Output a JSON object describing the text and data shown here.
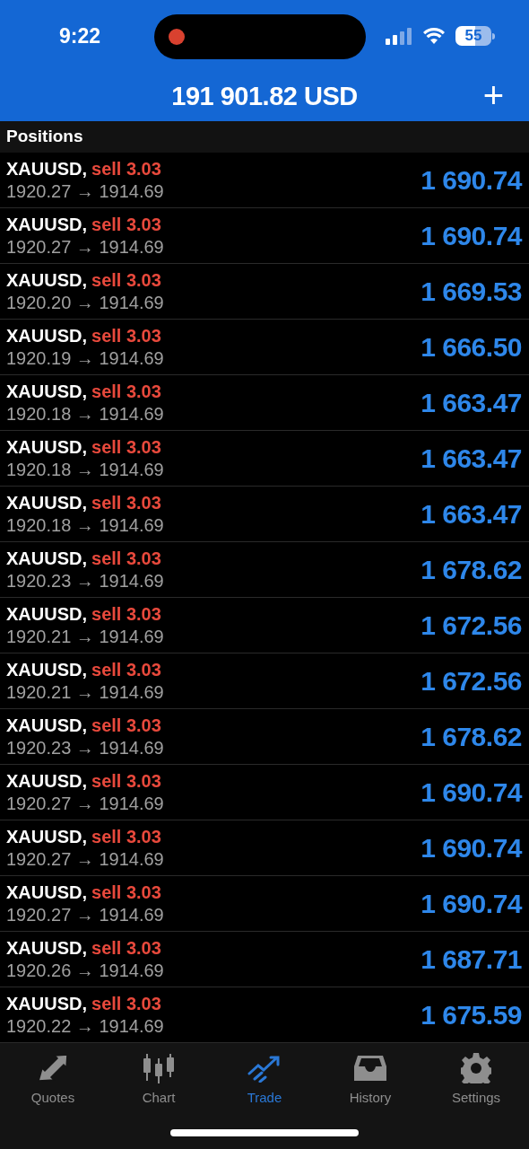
{
  "status_bar": {
    "time": "9:22",
    "battery": "55",
    "recording": true
  },
  "header": {
    "balance": "191 901.82 USD",
    "add_button": "+"
  },
  "section_title": "Positions",
  "positions": [
    {
      "symbol": "XAUUSD,",
      "side": "sell 3.03",
      "prices": "1920.27 → 1914.69",
      "profit": "1 690.74"
    },
    {
      "symbol": "XAUUSD,",
      "side": "sell 3.03",
      "prices": "1920.27 → 1914.69",
      "profit": "1 690.74"
    },
    {
      "symbol": "XAUUSD,",
      "side": "sell 3.03",
      "prices": "1920.20 → 1914.69",
      "profit": "1 669.53"
    },
    {
      "symbol": "XAUUSD,",
      "side": "sell 3.03",
      "prices": "1920.19 → 1914.69",
      "profit": "1 666.50"
    },
    {
      "symbol": "XAUUSD,",
      "side": "sell 3.03",
      "prices": "1920.18 → 1914.69",
      "profit": "1 663.47"
    },
    {
      "symbol": "XAUUSD,",
      "side": "sell 3.03",
      "prices": "1920.18 → 1914.69",
      "profit": "1 663.47"
    },
    {
      "symbol": "XAUUSD,",
      "side": "sell 3.03",
      "prices": "1920.18 → 1914.69",
      "profit": "1 663.47"
    },
    {
      "symbol": "XAUUSD,",
      "side": "sell 3.03",
      "prices": "1920.23 → 1914.69",
      "profit": "1 678.62"
    },
    {
      "symbol": "XAUUSD,",
      "side": "sell 3.03",
      "prices": "1920.21 → 1914.69",
      "profit": "1 672.56"
    },
    {
      "symbol": "XAUUSD,",
      "side": "sell 3.03",
      "prices": "1920.21 → 1914.69",
      "profit": "1 672.56"
    },
    {
      "symbol": "XAUUSD,",
      "side": "sell 3.03",
      "prices": "1920.23 → 1914.69",
      "profit": "1 678.62"
    },
    {
      "symbol": "XAUUSD,",
      "side": "sell 3.03",
      "prices": "1920.27 → 1914.69",
      "profit": "1 690.74"
    },
    {
      "symbol": "XAUUSD,",
      "side": "sell 3.03",
      "prices": "1920.27 → 1914.69",
      "profit": "1 690.74"
    },
    {
      "symbol": "XAUUSD,",
      "side": "sell 3.03",
      "prices": "1920.27 → 1914.69",
      "profit": "1 690.74"
    },
    {
      "symbol": "XAUUSD,",
      "side": "sell 3.03",
      "prices": "1920.26 → 1914.69",
      "profit": "1 687.71"
    },
    {
      "symbol": "XAUUSD,",
      "side": "sell 3.03",
      "prices": "1920.22 → 1914.69",
      "profit": "1 675.59"
    }
  ],
  "tabs": [
    {
      "label": "Quotes",
      "kind": "quotes",
      "selected": false
    },
    {
      "label": "Chart",
      "kind": "chart",
      "selected": false
    },
    {
      "label": "Trade",
      "kind": "trade",
      "selected": true
    },
    {
      "label": "History",
      "kind": "history",
      "selected": false
    },
    {
      "label": "Settings",
      "kind": "settings",
      "selected": false
    }
  ]
}
